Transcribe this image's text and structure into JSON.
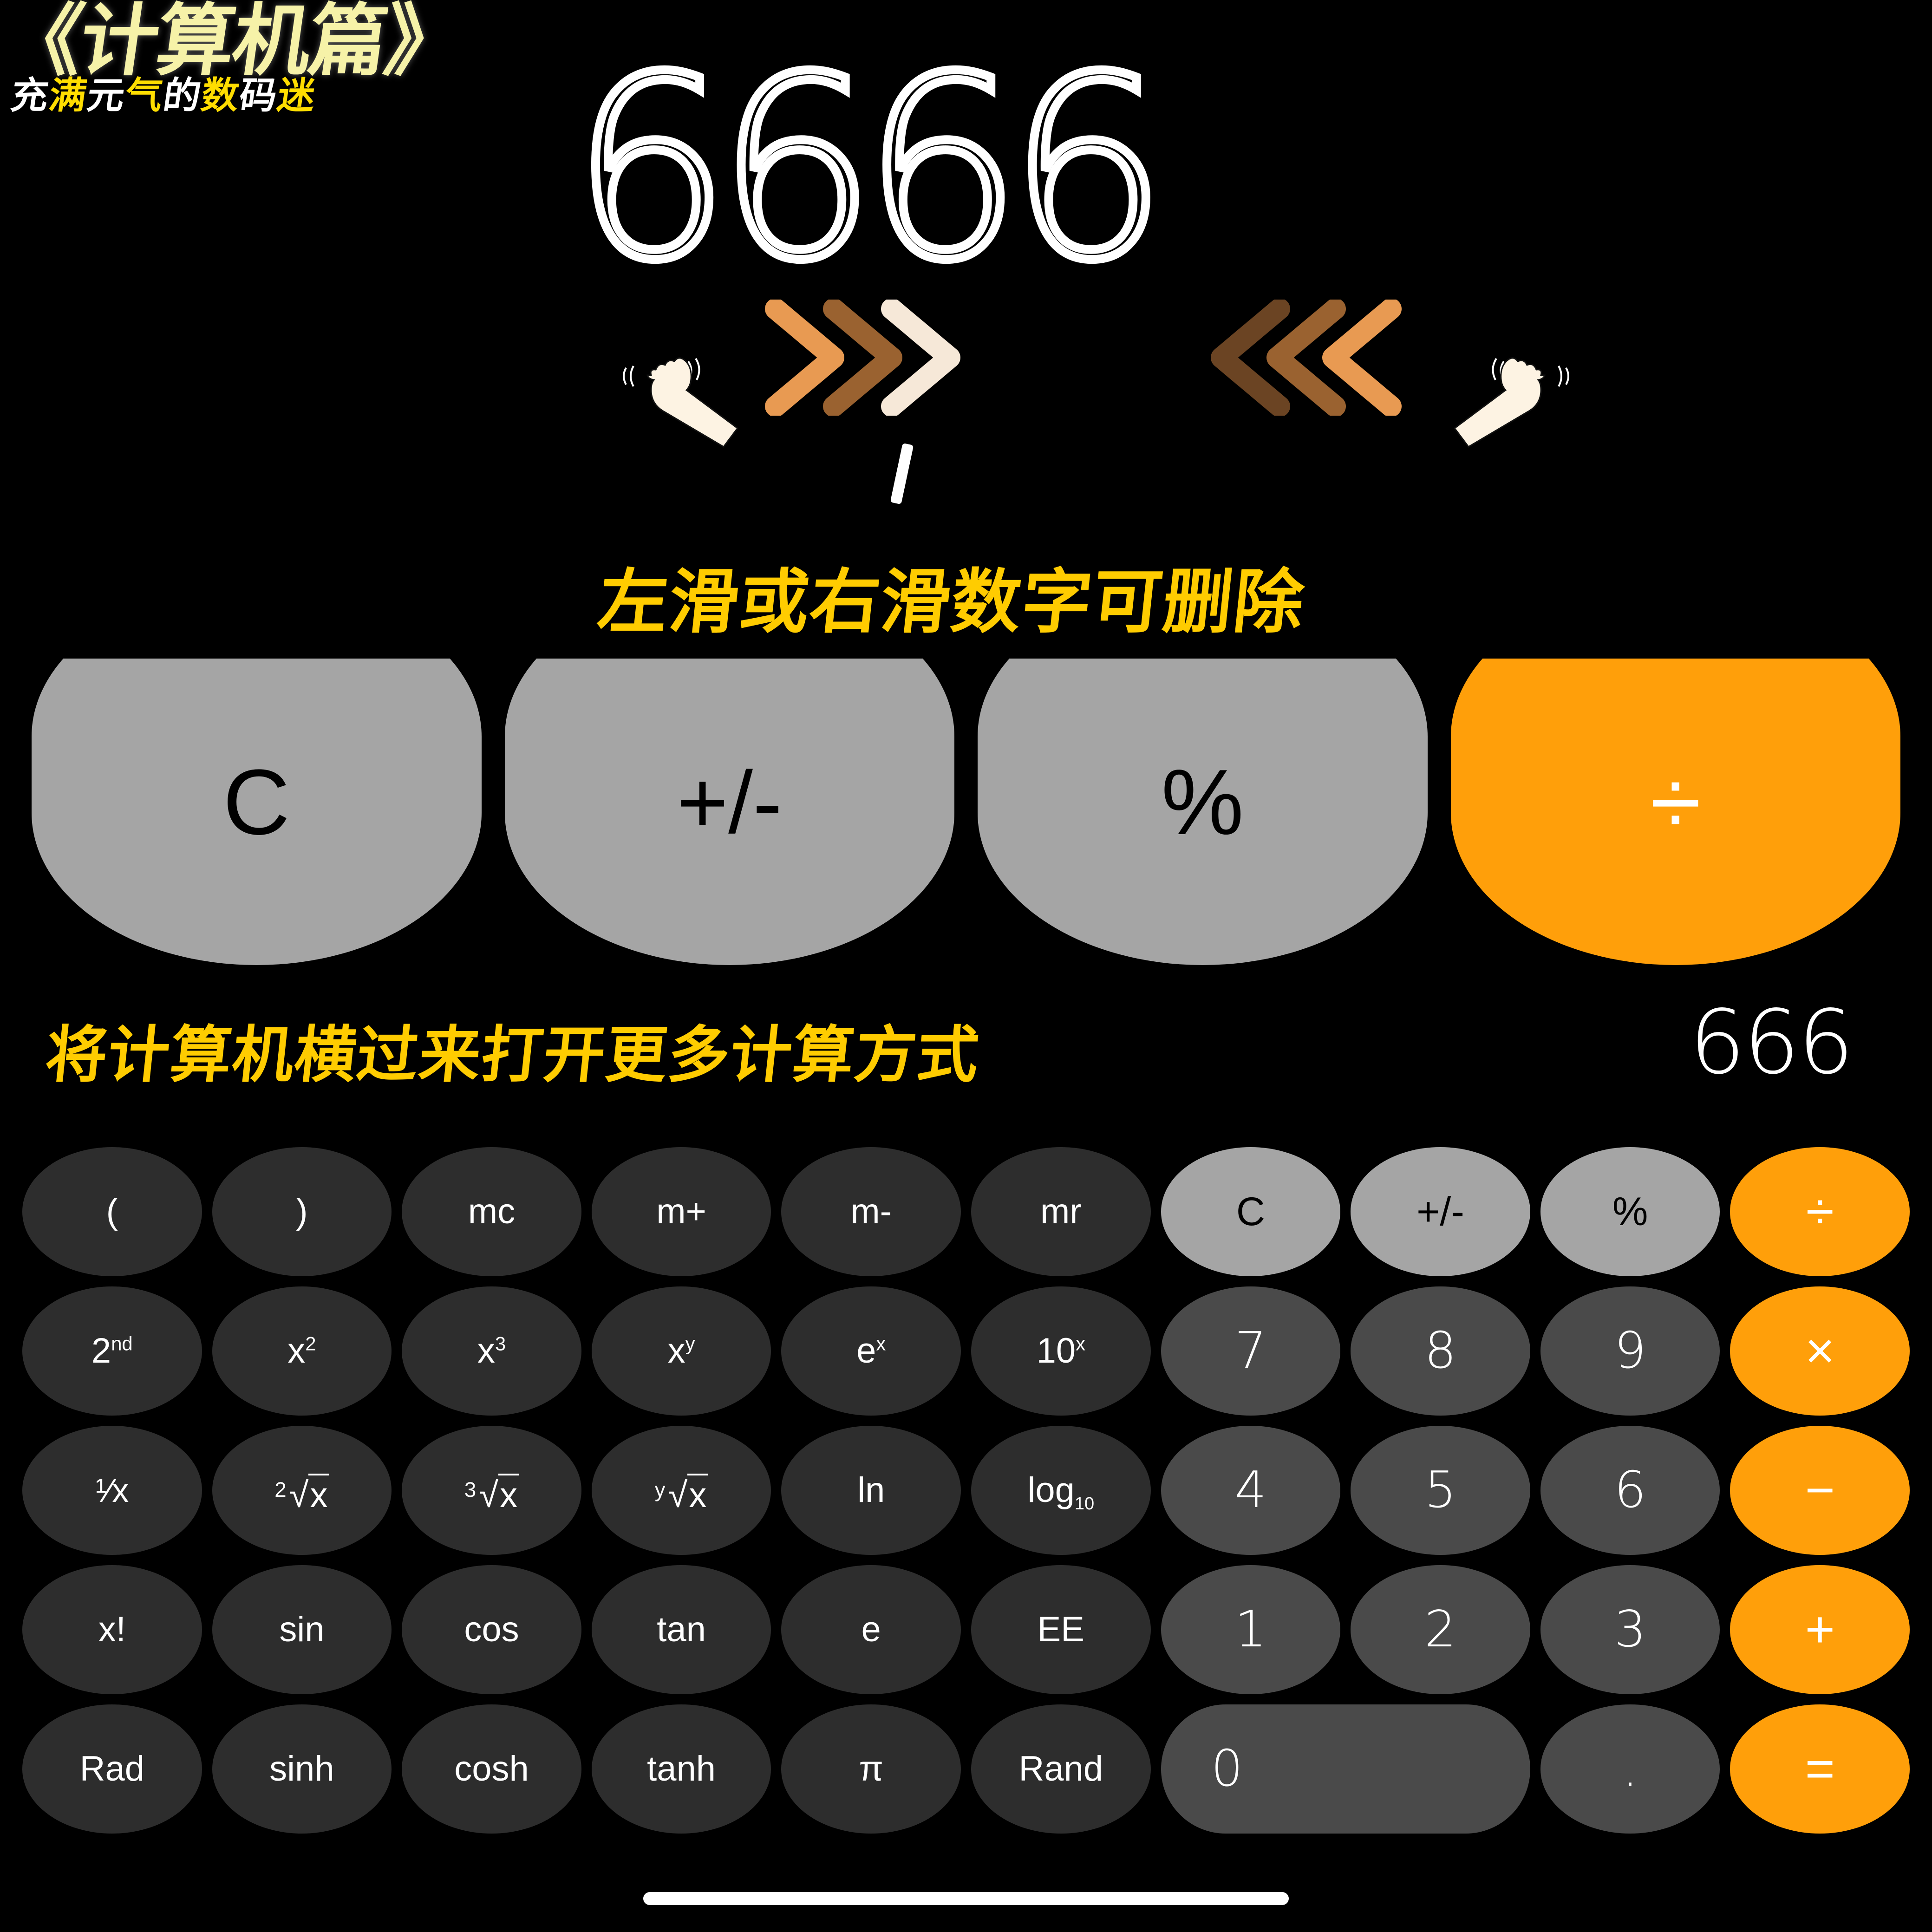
{
  "header": {
    "main_title": "《计算机篇》",
    "sub_title_parts": [
      {
        "text": "充",
        "color": "white"
      },
      {
        "text": "满",
        "color": "yellow"
      },
      {
        "text": "元",
        "color": "white"
      },
      {
        "text": "气",
        "color": "yellow"
      },
      {
        "text": "的",
        "color": "white"
      },
      {
        "text": "数",
        "color": "yellow"
      },
      {
        "text": "码",
        "color": "white"
      },
      {
        "text": "迷",
        "color": "yellow"
      }
    ],
    "title_color": "#f6f2a8"
  },
  "hero": {
    "big_digits": "6666",
    "gesture_right_label": "swipe-right-chevrons",
    "gesture_left_label": "swipe-left-chevrons",
    "hand_left_label": "hand-swipe-right",
    "hand_right_label": "hand-swipe-left"
  },
  "captions": {
    "caption1": "左滑或右滑数字可删除",
    "caption2": "将计算机横过来打开更多计算方式",
    "caption_color": "#ffcc00"
  },
  "portrait_row": {
    "buttons": [
      {
        "label": "C",
        "style": "gray"
      },
      {
        "label": "+/-",
        "style": "gray"
      },
      {
        "label": "%",
        "style": "gray"
      },
      {
        "label": "÷",
        "style": "orange"
      }
    ]
  },
  "display": {
    "value": "666"
  },
  "keypad": {
    "rows": [
      [
        {
          "label": "(",
          "style": "fn"
        },
        {
          "label": ")",
          "style": "fn"
        },
        {
          "label": "mc",
          "style": "fn"
        },
        {
          "label": "m+",
          "style": "fn"
        },
        {
          "label": "m-",
          "style": "fn"
        },
        {
          "label": "mr",
          "style": "fn"
        },
        {
          "label": "C",
          "style": "top"
        },
        {
          "label": "+/-",
          "style": "top"
        },
        {
          "label": "%",
          "style": "top"
        },
        {
          "label": "÷",
          "style": "op"
        }
      ],
      [
        {
          "label": "2nd",
          "style": "fn",
          "sup": "nd",
          "base": "2"
        },
        {
          "label": "x²",
          "style": "fn",
          "sup": "2",
          "base": "x"
        },
        {
          "label": "x³",
          "style": "fn",
          "sup": "3",
          "base": "x"
        },
        {
          "label": "xʸ",
          "style": "fn",
          "sup": "y",
          "base": "x"
        },
        {
          "label": "eˣ",
          "style": "fn",
          "sup": "x",
          "base": "e"
        },
        {
          "label": "10ˣ",
          "style": "fn",
          "sup": "x",
          "base": "10"
        },
        {
          "label": "7",
          "style": "num"
        },
        {
          "label": "8",
          "style": "num"
        },
        {
          "label": "9",
          "style": "num"
        },
        {
          "label": "×",
          "style": "op"
        }
      ],
      [
        {
          "label": "1/x",
          "style": "fn",
          "frac": "¹⁄x"
        },
        {
          "label": "²√x",
          "style": "fn",
          "radix": "2"
        },
        {
          "label": "³√x",
          "style": "fn",
          "radix": "3"
        },
        {
          "label": "ʸ√x",
          "style": "fn",
          "radix": "y"
        },
        {
          "label": "ln",
          "style": "fn"
        },
        {
          "label": "log10",
          "style": "fn",
          "base": "log",
          "sub": "10"
        },
        {
          "label": "4",
          "style": "num"
        },
        {
          "label": "5",
          "style": "num"
        },
        {
          "label": "6",
          "style": "num"
        },
        {
          "label": "−",
          "style": "op"
        }
      ],
      [
        {
          "label": "x!",
          "style": "fn"
        },
        {
          "label": "sin",
          "style": "fn"
        },
        {
          "label": "cos",
          "style": "fn"
        },
        {
          "label": "tan",
          "style": "fn"
        },
        {
          "label": "e",
          "style": "fn"
        },
        {
          "label": "EE",
          "style": "fn"
        },
        {
          "label": "1",
          "style": "num"
        },
        {
          "label": "2",
          "style": "num"
        },
        {
          "label": "3",
          "style": "num"
        },
        {
          "label": "+",
          "style": "op"
        }
      ],
      [
        {
          "label": "Rad",
          "style": "fn"
        },
        {
          "label": "sinh",
          "style": "fn"
        },
        {
          "label": "cosh",
          "style": "fn"
        },
        {
          "label": "tanh",
          "style": "fn"
        },
        {
          "label": "π",
          "style": "fn"
        },
        {
          "label": "Rand",
          "style": "fn"
        },
        {
          "label": "0",
          "style": "num",
          "wide": true
        },
        {
          "label": ".",
          "style": "num"
        },
        {
          "label": "=",
          "style": "op"
        }
      ]
    ]
  },
  "colors": {
    "background": "#000000",
    "orange": "#ff9f0a",
    "top_gray": "#a5a5a5",
    "num_gray": "#4a4a4a",
    "fn_gray": "#2d2d2d",
    "caption_yellow": "#ffcc00",
    "title_yellow": "#f6f2a8"
  },
  "system": {
    "home_indicator": "home-indicator-bar"
  }
}
